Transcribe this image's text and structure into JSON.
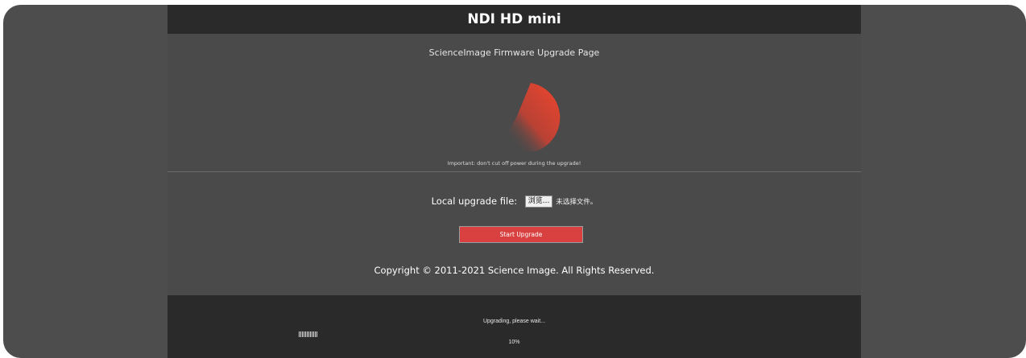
{
  "header": {
    "title": "NDI HD mini"
  },
  "page": {
    "subtitle": "ScienceImage Firmware Upgrade Page",
    "warning": "Important: don't cut off power during the upgrade!"
  },
  "upload": {
    "label": "Local upgrade file:",
    "browse_label": "浏览...",
    "no_file_text": "未选择文件。",
    "start_button": "Start Upgrade"
  },
  "footer": {
    "copyright": "Copyright © 2011-2021 Science Image. All Rights Reserved."
  },
  "progress": {
    "status": "Upgrading, please wait...",
    "percent_text": "10%",
    "percent": 10
  },
  "colors": {
    "accent": "#d94040",
    "header_bg": "#2a2a2a",
    "panel_bg": "#4a4a4a"
  },
  "icons": {
    "spinner": "loading-spinner-icon"
  }
}
